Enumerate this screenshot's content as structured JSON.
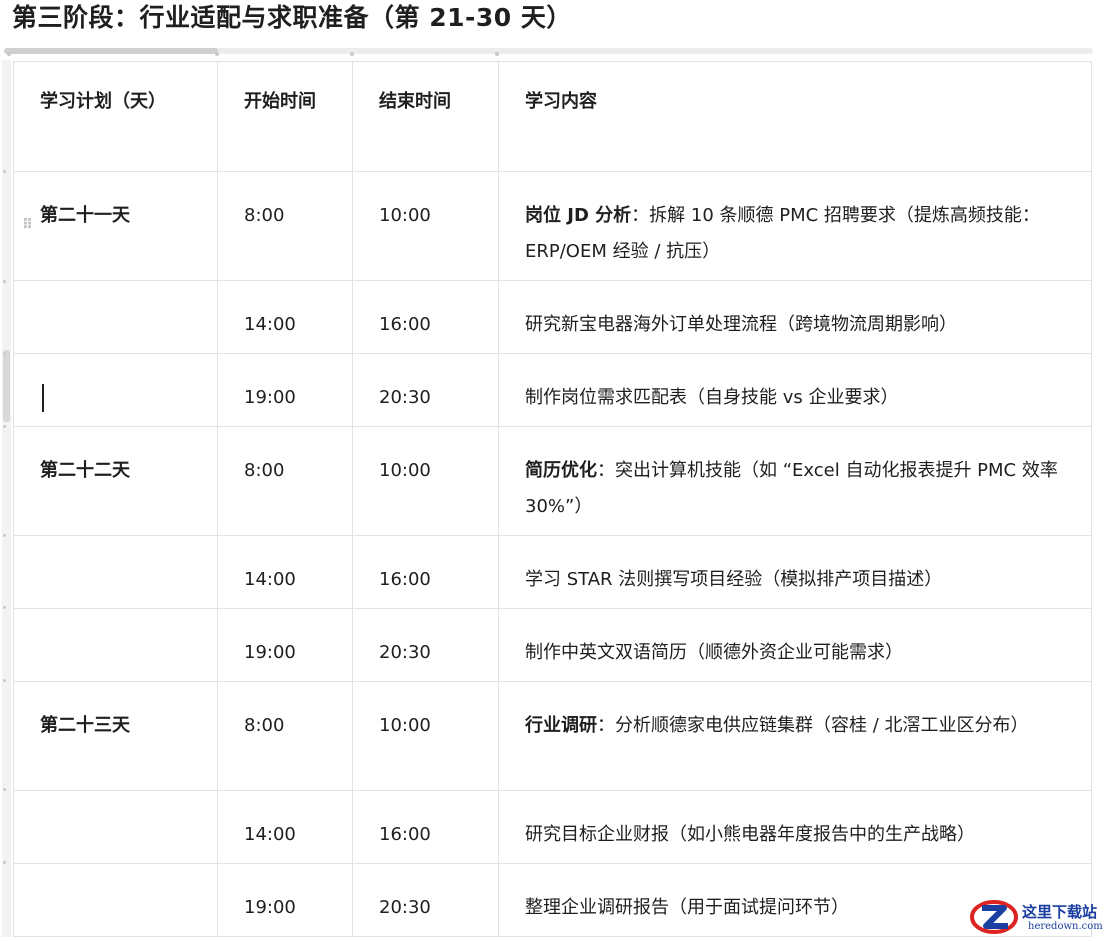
{
  "heading": "第三阶段：行业适配与求职准备（第 21-30 天）",
  "table": {
    "headers": [
      "学习计划（天）",
      "开始时间",
      "结束时间",
      "学习内容"
    ],
    "rows": [
      {
        "day": "第二十一天",
        "start": "8:00",
        "end": "10:00",
        "keyword": "岗位 JD 分析",
        "content": "：拆解 10 条顺德 PMC 招聘要求（提炼高频技能：ERP/OEM 经验 / 抗压）"
      },
      {
        "day": "",
        "start": "14:00",
        "end": "16:00",
        "keyword": "",
        "content": "研究新宝电器海外订单处理流程（跨境物流周期影响）"
      },
      {
        "day": "",
        "start": "19:00",
        "end": "20:30",
        "keyword": "",
        "content": "制作岗位需求匹配表（自身技能 vs 企业要求）"
      },
      {
        "day": "第二十二天",
        "start": "8:00",
        "end": "10:00",
        "keyword": "简历优化",
        "content": "：突出计算机技能（如 “Excel 自动化报表提升 PMC 效率 30%”）"
      },
      {
        "day": "",
        "start": "14:00",
        "end": "16:00",
        "keyword": "",
        "content": "学习 STAR 法则撰写项目经验（模拟排产项目描述）"
      },
      {
        "day": "",
        "start": "19:00",
        "end": "20:30",
        "keyword": "",
        "content": "制作中英文双语简历（顺德外资企业可能需求）"
      },
      {
        "day": "第二十三天",
        "start": "8:00",
        "end": "10:00",
        "keyword": "行业调研",
        "content": "：分析顺德家电供应链集群（容桂 / 北滘工业区分布）"
      },
      {
        "day": "",
        "start": "14:00",
        "end": "16:00",
        "keyword": "",
        "content": "研究目标企业财报（如小熊电器年度报告中的生产战略）"
      },
      {
        "day": "",
        "start": "19:00",
        "end": "20:30",
        "keyword": "",
        "content": "整理企业调研报告（用于面试提问环节）"
      }
    ]
  },
  "watermark": {
    "cn": "这里下载站",
    "en": "heredown.com"
  },
  "colors": {
    "border": "#e3e3e3",
    "logo": "#1a3fa0"
  }
}
